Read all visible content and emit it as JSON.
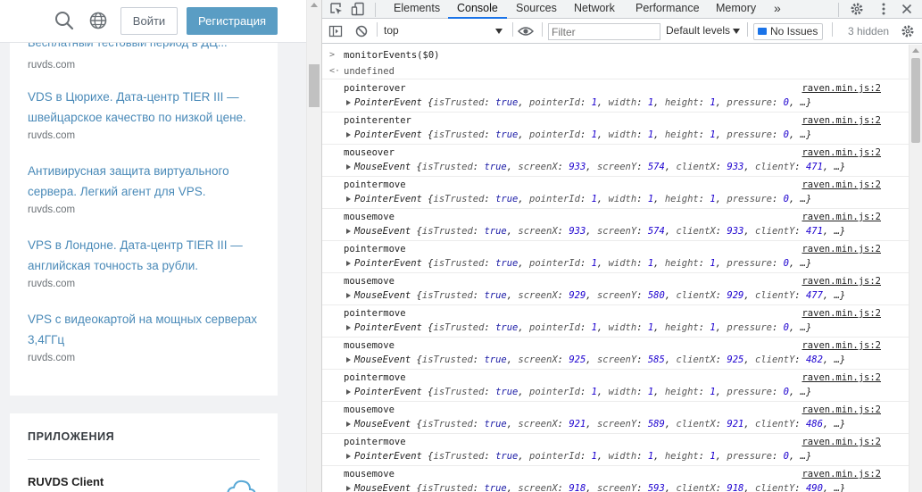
{
  "site": {
    "header": {
      "login_label": "Войти",
      "register_label": "Регистрация"
    },
    "news_partial_title": "Бесплатный тестовый период в ДЦ...",
    "news": [
      {
        "title": "VDS в Цюрихе. Дата-центр TIER III — швейцарское качество по низкой цене.",
        "domain": "ruvds.com"
      },
      {
        "title": "Антивирусная защита виртуального сервера. Легкий агент для VPS.",
        "domain": "ruvds.com"
      },
      {
        "title": "VPS в Лондоне. Дата-центр TIER III — английская точность за рубли.",
        "domain": "ruvds.com"
      },
      {
        "title": "VPS с видеокартой на мощных серверах 3,4ГГц",
        "domain": "ruvds.com"
      }
    ],
    "first_domain": "ruvds.com",
    "apps": {
      "title": "ПРИЛОЖЕНИЯ",
      "app_name": "RUVDS Client"
    }
  },
  "devtools": {
    "tabs": [
      {
        "label": "Elements",
        "active": false
      },
      {
        "label": "Console",
        "active": true
      },
      {
        "label": "Sources",
        "active": false
      },
      {
        "label": "Network",
        "active": false
      },
      {
        "label": "Performance",
        "active": false
      },
      {
        "label": "Memory",
        "active": false
      }
    ],
    "more_tabs": "»",
    "toolbar": {
      "context": "top",
      "filter_placeholder": "Filter",
      "levels": "Default levels",
      "issues": "No Issues",
      "hidden": "3 hidden"
    },
    "console": {
      "input": "monitorEvents($0)",
      "result": "undefined",
      "entries": [
        {
          "type": "pointerover",
          "src": "raven.min.js:2",
          "obj": "PointerEvent",
          "props": [
            [
              "isTrusted",
              "true",
              "bool"
            ],
            [
              "pointerId",
              "1",
              "num"
            ],
            [
              "width",
              "1",
              "num"
            ],
            [
              "height",
              "1",
              "num"
            ],
            [
              "pressure",
              "0",
              "num"
            ]
          ]
        },
        {
          "type": "pointerenter",
          "src": "raven.min.js:2",
          "obj": "PointerEvent",
          "props": [
            [
              "isTrusted",
              "true",
              "bool"
            ],
            [
              "pointerId",
              "1",
              "num"
            ],
            [
              "width",
              "1",
              "num"
            ],
            [
              "height",
              "1",
              "num"
            ],
            [
              "pressure",
              "0",
              "num"
            ]
          ]
        },
        {
          "type": "mouseover",
          "src": "raven.min.js:2",
          "obj": "MouseEvent",
          "props": [
            [
              "isTrusted",
              "true",
              "bool"
            ],
            [
              "screenX",
              "933",
              "num"
            ],
            [
              "screenY",
              "574",
              "num"
            ],
            [
              "clientX",
              "933",
              "num"
            ],
            [
              "clientY",
              "471",
              "num"
            ]
          ]
        },
        {
          "type": "pointermove",
          "src": "raven.min.js:2",
          "obj": "PointerEvent",
          "props": [
            [
              "isTrusted",
              "true",
              "bool"
            ],
            [
              "pointerId",
              "1",
              "num"
            ],
            [
              "width",
              "1",
              "num"
            ],
            [
              "height",
              "1",
              "num"
            ],
            [
              "pressure",
              "0",
              "num"
            ]
          ]
        },
        {
          "type": "mousemove",
          "src": "raven.min.js:2",
          "obj": "MouseEvent",
          "props": [
            [
              "isTrusted",
              "true",
              "bool"
            ],
            [
              "screenX",
              "933",
              "num"
            ],
            [
              "screenY",
              "574",
              "num"
            ],
            [
              "clientX",
              "933",
              "num"
            ],
            [
              "clientY",
              "471",
              "num"
            ]
          ]
        },
        {
          "type": "pointermove",
          "src": "raven.min.js:2",
          "obj": "PointerEvent",
          "props": [
            [
              "isTrusted",
              "true",
              "bool"
            ],
            [
              "pointerId",
              "1",
              "num"
            ],
            [
              "width",
              "1",
              "num"
            ],
            [
              "height",
              "1",
              "num"
            ],
            [
              "pressure",
              "0",
              "num"
            ]
          ]
        },
        {
          "type": "mousemove",
          "src": "raven.min.js:2",
          "obj": "MouseEvent",
          "props": [
            [
              "isTrusted",
              "true",
              "bool"
            ],
            [
              "screenX",
              "929",
              "num"
            ],
            [
              "screenY",
              "580",
              "num"
            ],
            [
              "clientX",
              "929",
              "num"
            ],
            [
              "clientY",
              "477",
              "num"
            ]
          ]
        },
        {
          "type": "pointermove",
          "src": "raven.min.js:2",
          "obj": "PointerEvent",
          "props": [
            [
              "isTrusted",
              "true",
              "bool"
            ],
            [
              "pointerId",
              "1",
              "num"
            ],
            [
              "width",
              "1",
              "num"
            ],
            [
              "height",
              "1",
              "num"
            ],
            [
              "pressure",
              "0",
              "num"
            ]
          ]
        },
        {
          "type": "mousemove",
          "src": "raven.min.js:2",
          "obj": "MouseEvent",
          "props": [
            [
              "isTrusted",
              "true",
              "bool"
            ],
            [
              "screenX",
              "925",
              "num"
            ],
            [
              "screenY",
              "585",
              "num"
            ],
            [
              "clientX",
              "925",
              "num"
            ],
            [
              "clientY",
              "482",
              "num"
            ]
          ]
        },
        {
          "type": "pointermove",
          "src": "raven.min.js:2",
          "obj": "PointerEvent",
          "props": [
            [
              "isTrusted",
              "true",
              "bool"
            ],
            [
              "pointerId",
              "1",
              "num"
            ],
            [
              "width",
              "1",
              "num"
            ],
            [
              "height",
              "1",
              "num"
            ],
            [
              "pressure",
              "0",
              "num"
            ]
          ]
        },
        {
          "type": "mousemove",
          "src": "raven.min.js:2",
          "obj": "MouseEvent",
          "props": [
            [
              "isTrusted",
              "true",
              "bool"
            ],
            [
              "screenX",
              "921",
              "num"
            ],
            [
              "screenY",
              "589",
              "num"
            ],
            [
              "clientX",
              "921",
              "num"
            ],
            [
              "clientY",
              "486",
              "num"
            ]
          ]
        },
        {
          "type": "pointermove",
          "src": "raven.min.js:2",
          "obj": "PointerEvent",
          "props": [
            [
              "isTrusted",
              "true",
              "bool"
            ],
            [
              "pointerId",
              "1",
              "num"
            ],
            [
              "width",
              "1",
              "num"
            ],
            [
              "height",
              "1",
              "num"
            ],
            [
              "pressure",
              "0",
              "num"
            ]
          ]
        },
        {
          "type": "mousemove",
          "src": "raven.min.js:2",
          "obj": "MouseEvent",
          "props": [
            [
              "isTrusted",
              "true",
              "bool"
            ],
            [
              "screenX",
              "918",
              "num"
            ],
            [
              "screenY",
              "593",
              "num"
            ],
            [
              "clientX",
              "918",
              "num"
            ],
            [
              "clientY",
              "490",
              "num"
            ]
          ]
        }
      ]
    }
  }
}
